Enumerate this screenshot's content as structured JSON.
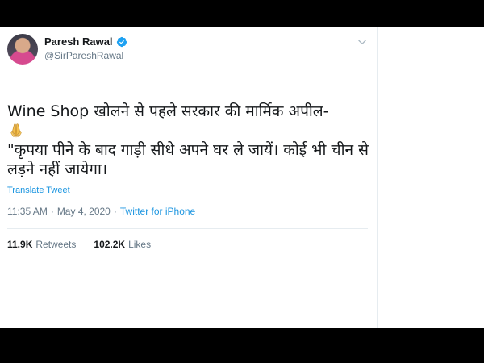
{
  "author": {
    "name": "Paresh Rawal",
    "handle": "@SirPareshRawal",
    "verified": true
  },
  "tweet": {
    "line1": "Wine Shop खोलने से पहले सरकार की मार्मिक अपील-",
    "emoji": "folded-hands",
    "line2": "\"कृपया पीने के बाद गाड़ी सीधे अपने घर ले जायें। कोई भी चीन से",
    "line3": "लड़ने नहीं जायेगा।",
    "translate_label": "Translate Tweet"
  },
  "meta": {
    "time": "11:35 AM",
    "separator": "·",
    "date": "May 4, 2020",
    "source_separator": "·",
    "source": "Twitter for iPhone"
  },
  "stats": {
    "retweets_count": "11.9K",
    "retweets_label": "Retweets",
    "likes_count": "102.2K",
    "likes_label": "Likes"
  },
  "colors": {
    "link": "#1b95e0",
    "secondary_text": "#657786",
    "primary_text": "#14171a",
    "verified": "#1da1f2",
    "frame": "#000000"
  }
}
